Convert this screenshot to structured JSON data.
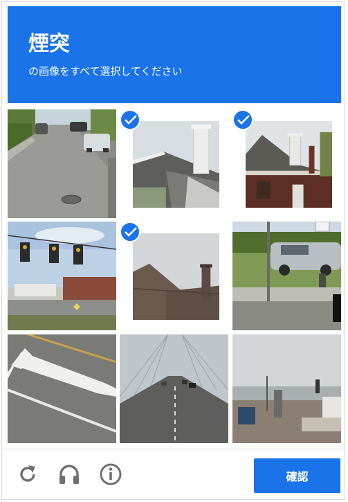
{
  "header": {
    "title": "煙突",
    "subtitle": "の画像をすべて選択してください"
  },
  "tiles": [
    {
      "name": "tile-street",
      "selected": false
    },
    {
      "name": "tile-roof-chimney-1",
      "selected": true
    },
    {
      "name": "tile-roof-chimney-2",
      "selected": true
    },
    {
      "name": "tile-traffic-lights",
      "selected": false
    },
    {
      "name": "tile-roof-chimney-3",
      "selected": true
    },
    {
      "name": "tile-parked-car",
      "selected": false
    },
    {
      "name": "tile-road-arrow",
      "selected": false
    },
    {
      "name": "tile-bridge",
      "selected": false
    },
    {
      "name": "tile-lot",
      "selected": false
    }
  ],
  "footer": {
    "reload_icon": "reload-icon",
    "audio_icon": "headphones-icon",
    "info_icon": "info-icon",
    "verify_label": "確認"
  },
  "colors": {
    "accent": "#1a73e8",
    "footer_icon": "#707070"
  }
}
